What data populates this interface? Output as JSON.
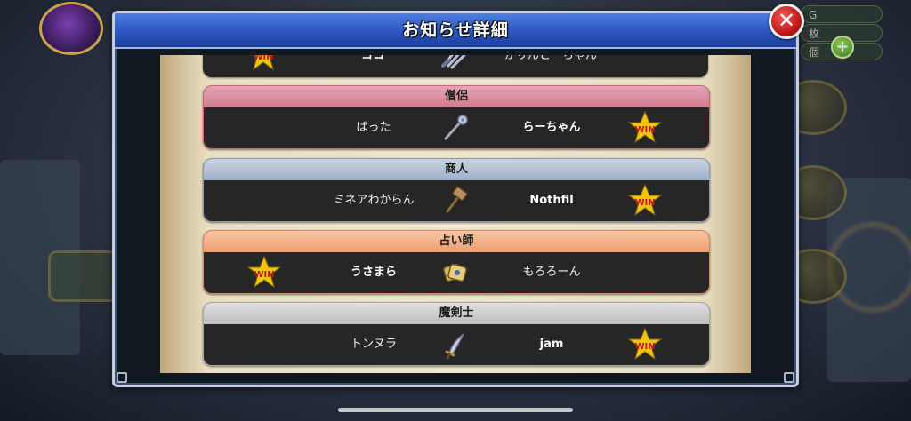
{
  "dialog": {
    "title": "お知らせ詳細",
    "close_icon": "close-icon"
  },
  "background": {
    "currency_g": "G",
    "currency_2": "枚",
    "currency_3": "個"
  },
  "results": [
    {
      "role": "",
      "left_player": "ココ",
      "right_player": "かりんとーちゃん",
      "winner": "left",
      "weapon_icon": "claw-icon",
      "partial": true
    },
    {
      "role": "僧侶",
      "left_player": "ばった",
      "right_player": "らーちゃん",
      "winner": "right",
      "weapon_icon": "staff-icon"
    },
    {
      "role": "商人",
      "left_player": "ミネアわからん",
      "right_player": "Nothfil",
      "winner": "right",
      "weapon_icon": "hammer-icon"
    },
    {
      "role": "占い師",
      "left_player": "うさまら",
      "right_player": "もろろーん",
      "winner": "left",
      "weapon_icon": "tarot-card-icon"
    },
    {
      "role": "魔剣士",
      "left_player": "トンヌラ",
      "right_player": "jam",
      "winner": "right",
      "weapon_icon": "scimitar-icon"
    }
  ],
  "win_badge_label": "WIN",
  "colors": {
    "header_blue": "#2a55c0",
    "priest": "#d27b90",
    "merchant": "#9fb0c8",
    "fortune_teller": "#ee9d6e",
    "magic_swordsman": "#bcbcbc",
    "win_star": "#f2c40c",
    "win_text": "#c0141a"
  }
}
